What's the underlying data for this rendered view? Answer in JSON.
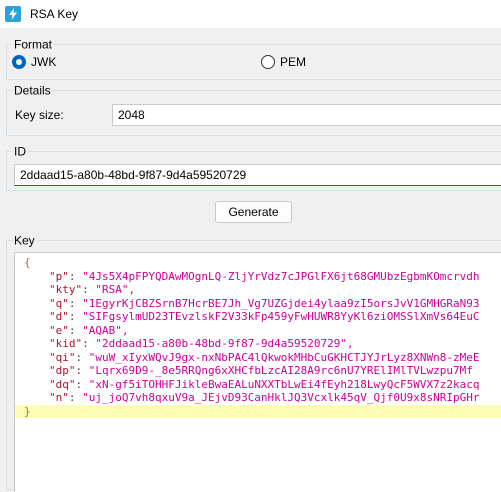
{
  "window": {
    "title": "RSA Key"
  },
  "format": {
    "label": "Format",
    "options": [
      {
        "label": "JWK",
        "selected": true
      },
      {
        "label": "PEM",
        "selected": false
      }
    ]
  },
  "details": {
    "label": "Details",
    "key_size_label": "Key size:",
    "key_size_value": "2048"
  },
  "id": {
    "label": "ID",
    "value": "2ddaad15-a80b-48bd-9f87-9d4a59520729"
  },
  "generate_label": "Generate",
  "key": {
    "label": "Key",
    "open_brace": "{",
    "close_brace": "}",
    "lines": [
      {
        "key": "\"p\"",
        "value": "\"4Js5X4pFPYQDAwMOgnLQ-ZljYrVdz7cJPGlFX6jt68GMUbzEgbmKOmcrvdh"
      },
      {
        "key": "\"kty\"",
        "value": "\"RSA\","
      },
      {
        "key": "\"q\"",
        "value": "\"1EgyrKjCBZSrnB7HcrBE7Jh_Vg7UZGjdei4ylaa9zI5orsJvV1GMHGRaN93"
      },
      {
        "key": "\"d\"",
        "value": "\"SIFgsylmUD23TEvzlskF2V33kFp459yFwHUWR8YyKl6ziOMSSlXmVs64EuC"
      },
      {
        "key": "\"e\"",
        "value": "\"AQAB\","
      },
      {
        "key": "\"kid\"",
        "value": "\"2ddaad15-a80b-48bd-9f87-9d4a59520729\","
      },
      {
        "key": "\"qi\"",
        "value": "\"wuW_xIyxWQvJ9gx-nxNbPAC4lQkwokMHbCuGKHCTJYJrLyz8XNWn8-zMeE"
      },
      {
        "key": "\"dp\"",
        "value": "\"Lqrx69D9-_8e5RRQng6xXHCfbLzcAI28A9rc6nU7YRElIMlTVLwzpu7Mf"
      },
      {
        "key": "\"dq\"",
        "value": "\"xN-gf5iTOHHFJiklеBwaEALuNXXTbLwEi4fEyh218LwyQcF5WVX7z2kacq"
      },
      {
        "key": "\"n\"",
        "value": "\"uj_joQ7vh8qxuV9a_JEjvD93CanHklJQ3Vcxlk45qV_Qjf0U9x8sNRIpGHr"
      }
    ]
  },
  "colors": {
    "accent": "#0067c0",
    "json_key": "#b8102b",
    "json_string": "#cc0099",
    "json_brace": "#c07020",
    "highlight_line": "#fdfdb8"
  }
}
